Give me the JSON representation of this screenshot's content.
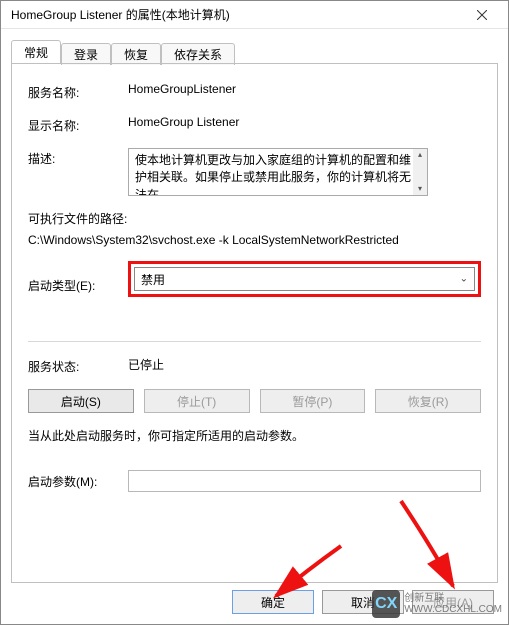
{
  "window": {
    "title": "HomeGroup Listener 的属性(本地计算机)"
  },
  "tabs": {
    "general": "常规",
    "logon": "登录",
    "recovery": "恢复",
    "dependencies": "依存关系"
  },
  "labels": {
    "service_name": "服务名称:",
    "display_name": "显示名称:",
    "description": "描述:",
    "exe_path": "可执行文件的路径:",
    "startup_type": "启动类型(E):",
    "service_status": "服务状态:",
    "start_params": "启动参数(M):"
  },
  "values": {
    "service_name": "HomeGroupListener",
    "display_name": "HomeGroup Listener",
    "description": "使本地计算机更改与加入家庭组的计算机的配置和维护相关联。如果停止或禁用此服务，你的计算机将无法在",
    "exe_path": "C:\\Windows\\System32\\svchost.exe -k LocalSystemNetworkRestricted",
    "startup_type": "禁用",
    "service_status": "已停止",
    "start_params": ""
  },
  "service_buttons": {
    "start": "启动(S)",
    "stop": "停止(T)",
    "pause": "暂停(P)",
    "resume": "恢复(R)"
  },
  "hint": "当从此处启动服务时，你可指定所适用的启动参数。",
  "dialog_buttons": {
    "ok": "确定",
    "cancel": "取消",
    "apply": "应用(A)"
  },
  "watermark": {
    "logo": "CX",
    "line1": "创新互联",
    "line2": "WWW.CDCXHL.COM"
  },
  "colors": {
    "highlight": "#e11"
  }
}
